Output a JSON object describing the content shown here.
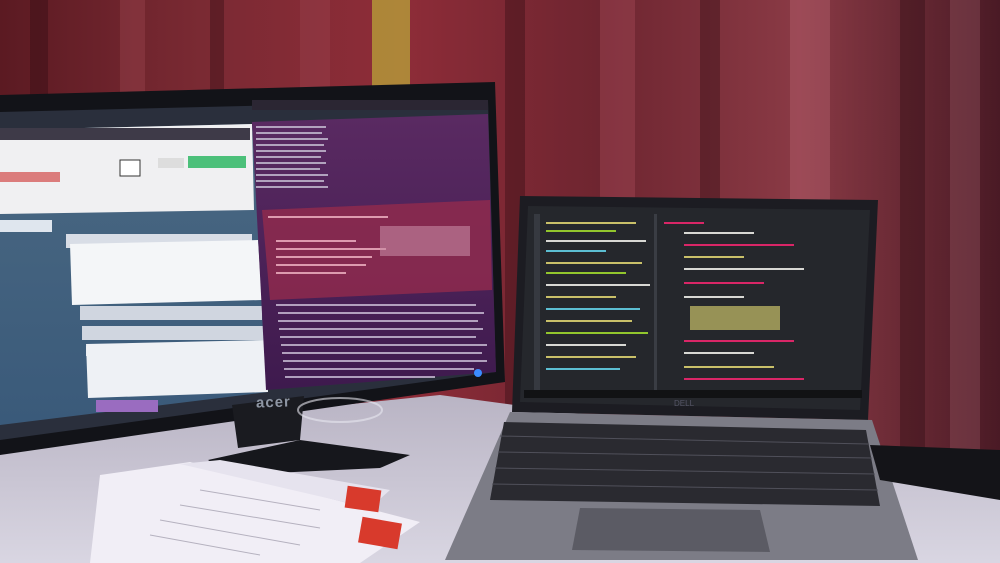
{
  "scene": {
    "description_free": true,
    "monitor": {
      "brand_text": "acer"
    },
    "laptop": {
      "brand_text": "DELL"
    }
  }
}
